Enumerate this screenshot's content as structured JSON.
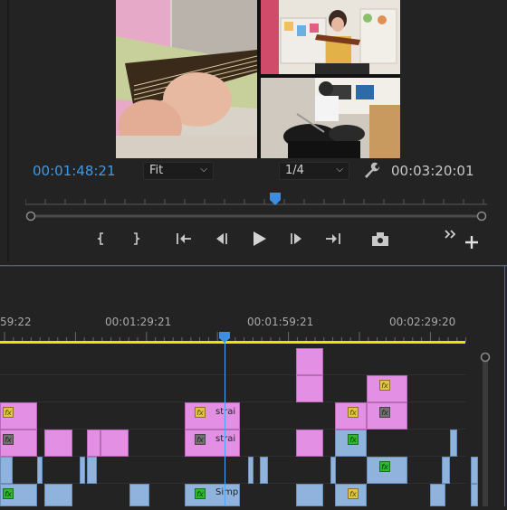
{
  "program_monitor": {
    "current_timecode": "00:01:48:21",
    "duration_timecode": "00:03:20:01",
    "zoom_select": "Fit",
    "resolution_select": "1/4"
  },
  "transport": {
    "icons": [
      "mark-in-icon",
      "mark-out-icon",
      "go-to-in-icon",
      "step-back-icon",
      "play-icon",
      "step-forward-icon",
      "go-to-out-icon",
      "export-frame-icon",
      "more-icon",
      "add-button-icon"
    ]
  },
  "timeline": {
    "ruler_labels": [
      "59:22",
      "00:01:29:21",
      "00:01:59:21",
      "00:02:29:20"
    ],
    "clip_label_strai_1": "strai",
    "clip_label_strai_2": "strai",
    "clip_label_simp": "Simp",
    "fx_label": "fx"
  },
  "colors": {
    "accent_blue": "#3d9ae8",
    "clip_pink": "#e38fe3",
    "clip_blue": "#8fb3dc",
    "work_area": "#e6e600"
  }
}
